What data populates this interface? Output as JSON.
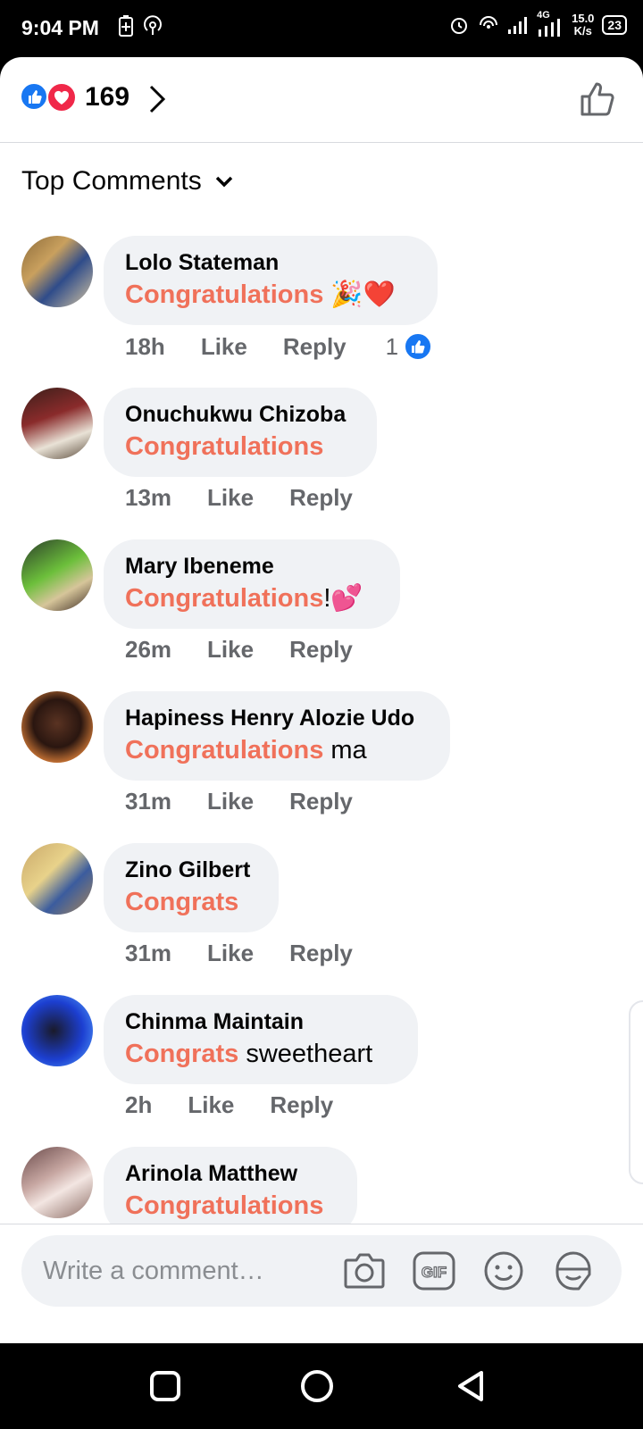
{
  "status_bar": {
    "time": "9:04 PM",
    "network": "4G",
    "speed_value": "15.0",
    "speed_unit": "K/s",
    "battery": "23"
  },
  "reactions": {
    "count": "169"
  },
  "sort": {
    "label": "Top Comments"
  },
  "comments": [
    {
      "name": "Lolo Stateman",
      "highlight": "Congratulations",
      "rest": " 🎉❤️",
      "time": "18h",
      "like": "Like",
      "reply": "Reply",
      "reaction_count": "1"
    },
    {
      "name": "Onuchukwu Chizoba",
      "highlight": "Congratulations",
      "rest": "",
      "time": "13m",
      "like": "Like",
      "reply": "Reply"
    },
    {
      "name": "Mary Ibeneme",
      "highlight": "Congratulations",
      "rest": "!💕",
      "time": "26m",
      "like": "Like",
      "reply": "Reply"
    },
    {
      "name": "Hapiness Henry Alozie Udo",
      "highlight": "Congratulations",
      "rest": " ma",
      "time": "31m",
      "like": "Like",
      "reply": "Reply"
    },
    {
      "name": "Zino Gilbert",
      "highlight": "Congrats",
      "rest": "",
      "time": "31m",
      "like": "Like",
      "reply": "Reply"
    },
    {
      "name": "Chinma Maintain",
      "highlight": "Congrats",
      "rest": " sweetheart",
      "time": "2h",
      "like": "Like",
      "reply": "Reply"
    },
    {
      "name": "Arinola Matthew",
      "highlight": "Congratulations",
      "rest": ""
    }
  ],
  "composer": {
    "placeholder": "Write a comment…"
  },
  "icons": {
    "like": "like-icon",
    "love": "love-icon",
    "camera": "camera-icon",
    "gif": "gif-icon",
    "emoji": "emoji-icon",
    "sticker": "sticker-icon",
    "back": "back-icon",
    "home": "home-icon",
    "recents": "recents-icon"
  },
  "colors": {
    "highlight": "#f0715a",
    "like_blue": "#1877f2",
    "love_red": "#f02849",
    "bubble": "#f0f2f5"
  }
}
